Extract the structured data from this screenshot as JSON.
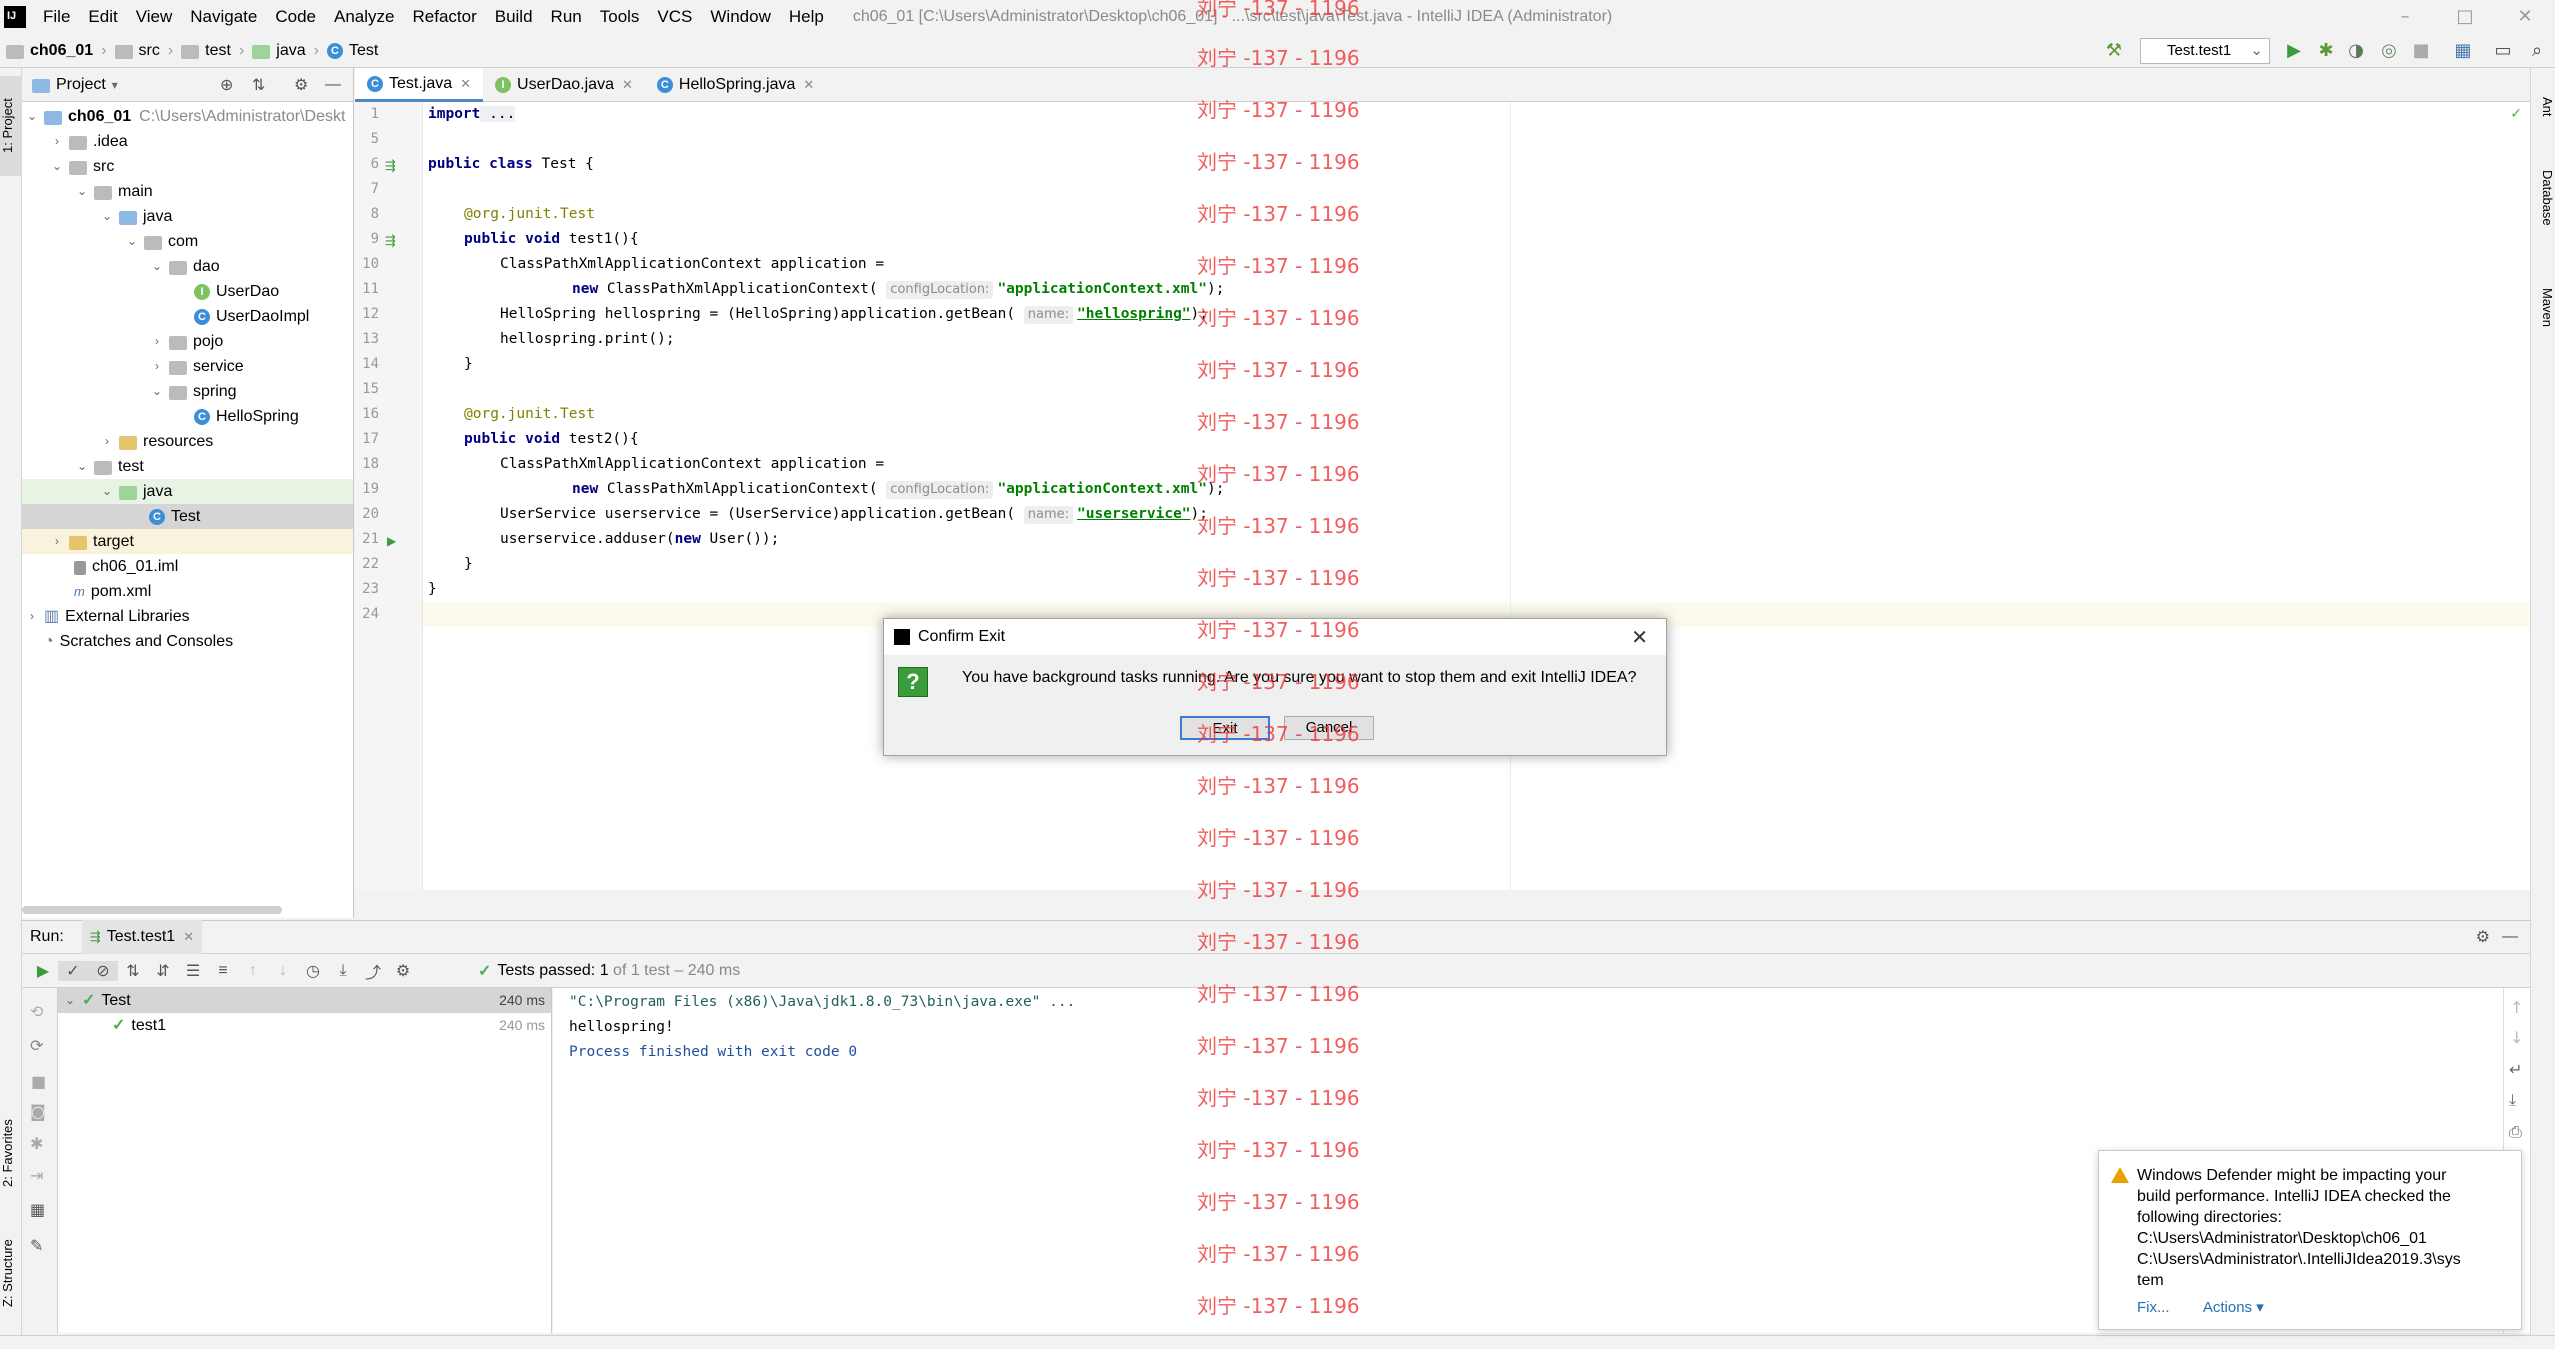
{
  "window": {
    "title": "ch06_01 [C:\\Users\\Administrator\\Desktop\\ch06_01] - ...\\src\\test\\java\\Test.java - IntelliJ IDEA (Administrator)",
    "minimize": "–",
    "maximize": "□",
    "close": "✕"
  },
  "menu": [
    "File",
    "Edit",
    "View",
    "Navigate",
    "Code",
    "Analyze",
    "Refactor",
    "Build",
    "Run",
    "Tools",
    "VCS",
    "Window",
    "Help"
  ],
  "breadcrumb": [
    "ch06_01",
    "src",
    "test",
    "java",
    "Test"
  ],
  "toolbar": {
    "run_config": "Test.test1"
  },
  "project": {
    "header": "Project",
    "root_path": "C:\\Users\\Administrator\\Deskt",
    "items": [
      "ch06_01",
      ".idea",
      "src",
      "main",
      "java",
      "com",
      "dao",
      "UserDao",
      "UserDaoImpl",
      "pojo",
      "service",
      "spring",
      "HelloSpring",
      "resources",
      "test",
      "java",
      "Test",
      "target",
      "ch06_01.iml",
      "pom.xml",
      "External Libraries",
      "Scratches and Consoles"
    ]
  },
  "tabs": [
    "Test.java",
    "UserDao.java",
    "HelloSpring.java"
  ],
  "code": {
    "line_numbers": [
      "1",
      "5",
      "6",
      "7",
      "8",
      "9",
      "10",
      "11",
      "12",
      "13",
      "14",
      "15",
      "16",
      "17",
      "18",
      "19",
      "20",
      "21",
      "22",
      "23",
      "24"
    ],
    "import_kw": "import",
    "import_rest": " ...",
    "public_kw": "public",
    "class_kw": "class",
    "class_name": " Test {",
    "ann_prefix": "@org.junit.",
    "ann_test": "Test",
    "void_kw": "void",
    "test1_sig": " test1(){",
    "test2_sig": " test2(){",
    "ctx_decl": "ClassPathXmlApplicationContext application =",
    "new_kw": "new",
    "ctx_new": " ClassPathXmlApplicationContext(",
    "hint_config": "configLocation:",
    "str_ctx": "\"applicationContext.xml\"",
    "close_semi": ");",
    "hello_decl": "HelloSpring hellospring = (HelloSpring)application.getBean(",
    "hint_name": "name:",
    "str_hello": "\"hellospring\"",
    "hello_print": "hellospring.print();",
    "close_brace": "}",
    "user_decl": "UserService userservice = (UserService)application.getBean(",
    "str_user": "\"userservice\"",
    "adduser_a": "userservice.adduser(",
    "adduser_b": " User());"
  },
  "run": {
    "label": "Run:",
    "tab": "Test.test1",
    "status_prefix": "Tests passed:",
    "status_count": "1",
    "status_suffix": "of 1 test – 240 ms",
    "tree": [
      {
        "name": "Test",
        "time": "240 ms"
      },
      {
        "name": "test1",
        "time": "240 ms"
      }
    ],
    "console": [
      "\"C:\\Program Files (x86)\\Java\\jdk1.8.0_73\\bin\\java.exe\" ...",
      "hellospring!",
      "Process finished with exit code 0"
    ]
  },
  "dialog": {
    "title": "Confirm Exit",
    "message": "You have background tasks running. Are you sure you want to stop them and exit IntelliJ IDEA?",
    "exit_label": "Exit",
    "cancel_label": "Cancel"
  },
  "notification": {
    "lines": [
      "Windows Defender might be impacting your",
      "build performance. IntelliJ IDEA checked the",
      "following directories:",
      "C:\\Users\\Administrator\\Desktop\\ch06_01",
      "C:\\Users\\Administrator\\.IntelliJIdea2019.3\\sys",
      "tem"
    ],
    "fix": "Fix...",
    "actions": "Actions ▾"
  },
  "side_labels": {
    "project": "1: Project",
    "favorites": "2: Favorites",
    "structure": "Z: Structure",
    "ant": "Ant",
    "database": "Database",
    "maven": "Maven"
  },
  "watermark": "刘宁 -137 - 1196",
  "colors": {
    "accent": "#4a88c7",
    "keyword": "#000080",
    "string": "#008000",
    "annotation": "#808000",
    "watermark": "#ee3b3b"
  }
}
